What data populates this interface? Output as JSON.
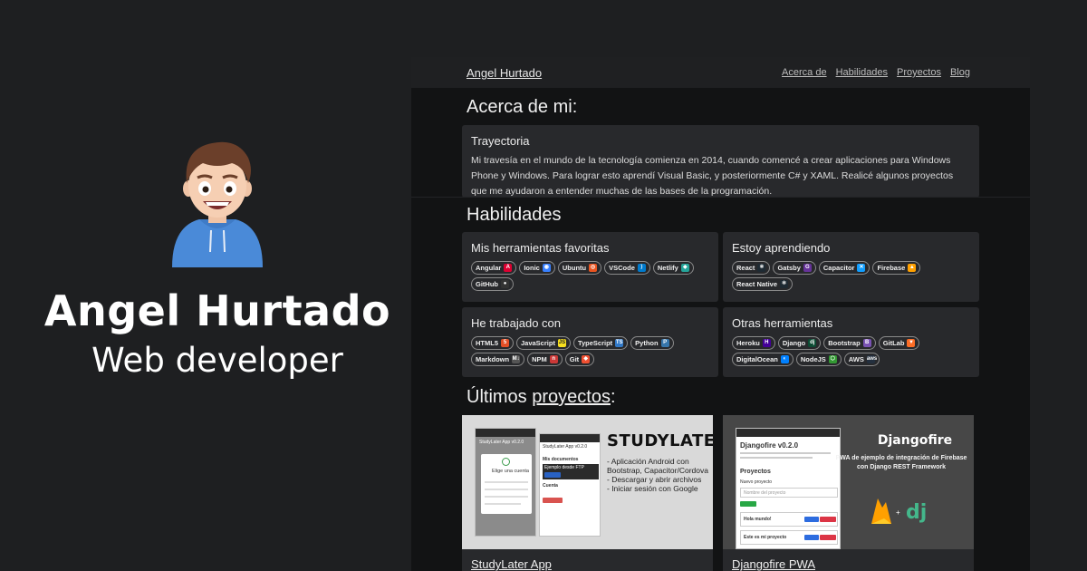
{
  "profile": {
    "name": "Angel Hurtado",
    "role": "Web developer"
  },
  "site": {
    "brand": "Angel Hurtado",
    "nav": [
      "Acerca de",
      "Habilidades",
      "Proyectos",
      "Blog"
    ],
    "about": {
      "heading": "Acerca de mi:",
      "card_title": "Trayectoria",
      "text": "Mi travesía en el mundo de la tecnología comienza en 2014, cuando comencé a crear aplicaciones para Windows Phone y Windows. Para lograr esto aprendí Visual Basic, y posteriormente C# y XAML. Realicé algunos proyectos que me ayudaron a entender muchas de las bases de la programación."
    },
    "skills": {
      "heading": "Habilidades",
      "cards": [
        {
          "title": "Mis herramientas favoritas",
          "chips": [
            {
              "label": "Angular",
              "icon": "angular-icon",
              "color": "#dd0031",
              "glyph": "A"
            },
            {
              "label": "Ionic",
              "icon": "ionic-icon",
              "color": "#3880ff",
              "glyph": "◉"
            },
            {
              "label": "Ubuntu",
              "icon": "ubuntu-icon",
              "color": "#e95420",
              "glyph": "◎"
            },
            {
              "label": "VSCode",
              "icon": "vscode-icon",
              "color": "#007acc",
              "glyph": "⟩"
            },
            {
              "label": "Netlify",
              "icon": "netlify-icon",
              "color": "#25a59a",
              "glyph": "◆"
            },
            {
              "label": "GitHub",
              "icon": "github-icon",
              "color": "#333333",
              "glyph": "●"
            }
          ]
        },
        {
          "title": "Estoy aprendiendo",
          "chips": [
            {
              "label": "React",
              "icon": "react-icon",
              "color": "#1e2a33",
              "glyph": "⚛"
            },
            {
              "label": "Gatsby",
              "icon": "gatsby-icon",
              "color": "#663399",
              "glyph": "G"
            },
            {
              "label": "Capacitor",
              "icon": "capacitor-icon",
              "color": "#119eff",
              "glyph": "✕"
            },
            {
              "label": "Firebase",
              "icon": "firebase-icon",
              "color": "#ffa000",
              "glyph": "▲"
            },
            {
              "label": "React Native",
              "icon": "react-native-icon",
              "color": "#1e2a33",
              "glyph": "⚛"
            }
          ]
        },
        {
          "title": "He trabajado con",
          "chips": [
            {
              "label": "HTML5",
              "icon": "html5-icon",
              "color": "#e34f26",
              "glyph": "5"
            },
            {
              "label": "JavaScript",
              "icon": "javascript-icon",
              "color": "#f7df1e",
              "glyph": "JS"
            },
            {
              "label": "TypeScript",
              "icon": "typescript-icon",
              "color": "#3178c6",
              "glyph": "TS"
            },
            {
              "label": "Python",
              "icon": "python-icon",
              "color": "#3776ab",
              "glyph": "P"
            },
            {
              "label": "Markdown",
              "icon": "markdown-icon",
              "color": "#555555",
              "glyph": "M↓"
            },
            {
              "label": "NPM",
              "icon": "npm-icon",
              "color": "#cb3837",
              "glyph": "n"
            },
            {
              "label": "Git",
              "icon": "git-icon",
              "color": "#f05032",
              "glyph": "◆"
            }
          ]
        },
        {
          "title": "Otras herramientas",
          "chips": [
            {
              "label": "Heroku",
              "icon": "heroku-icon",
              "color": "#430098",
              "glyph": "H"
            },
            {
              "label": "Django",
              "icon": "django-icon",
              "color": "#0c4b33",
              "glyph": "dj"
            },
            {
              "label": "Bootstrap",
              "icon": "bootstrap-icon",
              "color": "#7952b3",
              "glyph": "B"
            },
            {
              "label": "GitLab",
              "icon": "gitlab-icon",
              "color": "#fc6d26",
              "glyph": "▼"
            },
            {
              "label": "DigitalOcean",
              "icon": "digitalocean-icon",
              "color": "#0080ff",
              "glyph": "◐"
            },
            {
              "label": "NodeJS",
              "icon": "nodejs-icon",
              "color": "#339933",
              "glyph": "⬡"
            },
            {
              "label": "AWS",
              "icon": "aws-icon",
              "color": "#232f3e",
              "glyph": "aws"
            }
          ]
        }
      ]
    },
    "projects": {
      "heading_prefix": "Últimos ",
      "heading_link": "proyectos",
      "heading_suffix": ":",
      "items": [
        {
          "label": "StudyLater App",
          "thumb_title": "STUDYLATER",
          "thumb_desc": "- Aplicación Android con Bootstrap, Capacitor/Cordova\n- Descargar y abrir archivos\n- Iniciar sesión con Google",
          "phone1_title": "StudyLater App v0.2.0",
          "phone1_dialog": "Elige una cuenta",
          "phone2_title": "StudyLater App v0.2.0",
          "phone2_section": "Mis documentos",
          "phone2_item": "Ejemplo desde FTP",
          "phone2_account": "Cuenta"
        },
        {
          "label": "Djangofire PWA",
          "thumb_title": "Djangofire",
          "thumb_desc": "PWA de ejemplo de integración de Firebase con Django REST Framework",
          "phone_title": "Djangofire v0.2.0",
          "phone_section": "Proyectos",
          "phone_new": "Nuevo proyecto",
          "phone_input": "Nombre del proyecto",
          "phone_item1": "Hola mundo!",
          "phone_item2": "Este es mi proyecto"
        }
      ]
    }
  },
  "colors": {
    "page_bg": "#1e1f21",
    "site_bg": "#121314",
    "card_bg": "#28292c",
    "text": "#e7e7e7"
  }
}
